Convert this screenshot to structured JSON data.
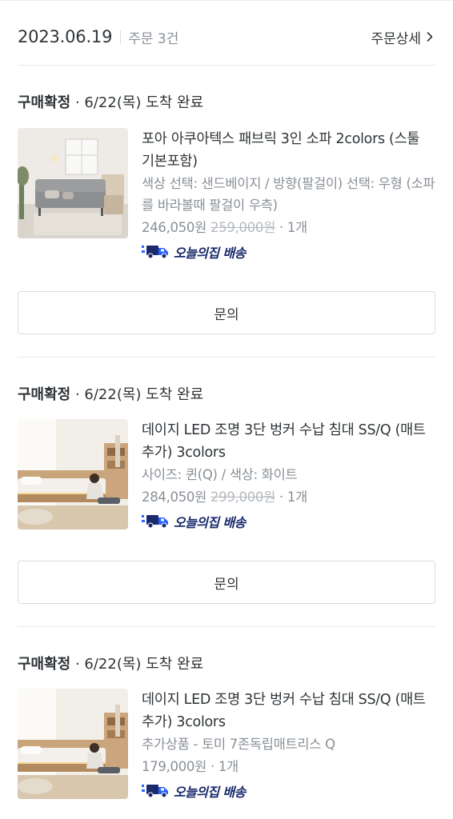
{
  "order": {
    "date": "2023.06.19",
    "count": "주문 3건",
    "detail_label": "주문상세"
  },
  "items": [
    {
      "status_bold": "구매확정",
      "status_rest": " · 6/22(목) 도착 완료",
      "name": "포아 아쿠아텍스 패브릭 3인 소파 2colors (스툴 기본포함)",
      "option": "색상 선택: 샌드베이지 / 방향(팔걸이) 선택: 우형 (소파를 바라볼때 팔걸이 우측)",
      "price": "246,050원",
      "original_price": "259,000원",
      "qty": " · 1개",
      "delivery": "오늘의집 배송",
      "inquiry_label": "문의"
    },
    {
      "status_bold": "구매확정",
      "status_rest": " · 6/22(목) 도착 완료",
      "name": "데이지 LED 조명 3단 벙커 수납 침대 SS/Q (매트 추가) 3colors",
      "option": "사이즈: 퀸(Q) / 색상: 화이트",
      "price": "284,050원",
      "original_price": "299,000원",
      "qty": " · 1개",
      "delivery": "오늘의집 배송",
      "inquiry_label": "문의"
    },
    {
      "status_bold": "구매확정",
      "status_rest": " · 6/22(목) 도착 완료",
      "name": "데이지 LED 조명 3단 벙커 수납 침대 SS/Q (매트 추가) 3colors",
      "option": "추가상품 - 토미 7존독립매트리스 Q",
      "price": "179,000원",
      "qty": " · 1개",
      "delivery": "오늘의집 배송"
    }
  ],
  "colors": {
    "text": "#2f3438",
    "muted": "#8a9097",
    "delivery_blue": "#1a2b6d",
    "truck_blue": "#2a63ff"
  },
  "icons": {
    "detail": "chevron-right-icon",
    "delivery": "delivery-truck-icon"
  }
}
